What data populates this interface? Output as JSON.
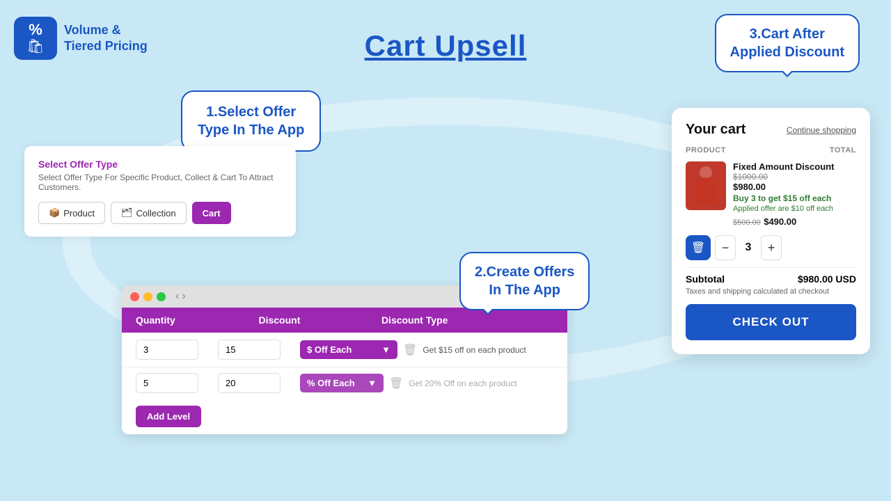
{
  "logo": {
    "icon_pct": "%",
    "icon_bag": "🛍",
    "text_line1": "Volume &",
    "text_line2": "Tiered Pricing"
  },
  "page_title": "Cart Upsell",
  "bubble1": {
    "line1": "1.Select Offer",
    "line2": "Type In The App"
  },
  "offer_type_panel": {
    "title": "Select Offer Type",
    "desc": "Select Offer Type For Specific Product, Collect & Cart To Attract Customers.",
    "btn_product": "Product",
    "btn_collection": "Collection",
    "btn_cart": "Cart"
  },
  "bubble2": {
    "line1": "2.Create Offers",
    "line2": "In The App"
  },
  "table": {
    "col1": "Quantity",
    "col2": "Discount",
    "col3": "Discount Type",
    "row1": {
      "qty": "3",
      "discount": "15",
      "type": "$ Off Each",
      "info": "Get $15 off on each product"
    },
    "row2": {
      "qty": "5",
      "discount": "20",
      "type": "% Off Each",
      "info": "Get 20% Off on each product"
    },
    "add_level": "Add Level"
  },
  "bubble3": {
    "line1": "3.Cart After",
    "line2": "Applied Discount"
  },
  "cart": {
    "title": "Your cart",
    "continue_shopping": "Continue shopping",
    "col_product": "PRODUCT",
    "col_total": "TOTAL",
    "product_name": "Fixed Amount Discount",
    "price_original": "$1000.00",
    "price_current": "$980.00",
    "promo_text": "Buy 3 to get $15 off each",
    "applied_offer": "Applied offer are $10 off each",
    "price_striked": "$500.00",
    "price_sale": "$490.00",
    "quantity": "3",
    "subtotal_label": "Subtotal",
    "subtotal_value": "$980.00 USD",
    "tax_note": "Taxes and shipping calculated at checkout",
    "checkout_label": "CHECK OUT"
  }
}
